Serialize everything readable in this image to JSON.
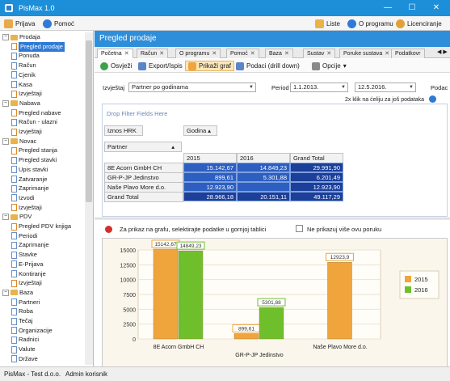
{
  "window": {
    "title": "PisMax 1.0"
  },
  "menu": {
    "items": [
      {
        "label": "Prijava"
      },
      {
        "label": "Pomoć"
      }
    ],
    "right": [
      {
        "label": "Liste"
      },
      {
        "label": "O programu"
      },
      {
        "label": "Licenciranje"
      }
    ]
  },
  "sidebar": {
    "items": [
      {
        "label": "Prodaja",
        "level": 0,
        "type": "group"
      },
      {
        "label": "Pregled prodaje",
        "level": 1,
        "type": "chart",
        "selected": true
      },
      {
        "label": "Ponuda",
        "level": 1,
        "type": "doc"
      },
      {
        "label": "Račun",
        "level": 1,
        "type": "doc"
      },
      {
        "label": "Cjenik",
        "level": 1,
        "type": "doc"
      },
      {
        "label": "Kasa",
        "level": 1,
        "type": "doc"
      },
      {
        "label": "Izvještaji",
        "level": 1,
        "type": "chart"
      },
      {
        "label": "Nabava",
        "level": 0,
        "type": "group"
      },
      {
        "label": "Pregled nabave",
        "level": 1,
        "type": "chart"
      },
      {
        "label": "Račun - ulazni",
        "level": 1,
        "type": "doc"
      },
      {
        "label": "Izvještaji",
        "level": 1,
        "type": "chart"
      },
      {
        "label": "Novac",
        "level": 0,
        "type": "group"
      },
      {
        "label": "Pregled stanja",
        "level": 1,
        "type": "chart"
      },
      {
        "label": "Pregled stavki",
        "level": 1,
        "type": "doc"
      },
      {
        "label": "Upis stavki",
        "level": 1,
        "type": "doc"
      },
      {
        "label": "Zatvaranje",
        "level": 1,
        "type": "doc"
      },
      {
        "label": "Zaprimanje",
        "level": 1,
        "type": "doc"
      },
      {
        "label": "Izvodi",
        "level": 1,
        "type": "doc"
      },
      {
        "label": "Izvještaji",
        "level": 1,
        "type": "chart"
      },
      {
        "label": "PDV",
        "level": 0,
        "type": "group"
      },
      {
        "label": "Pregled PDV knjiga",
        "level": 1,
        "type": "chart"
      },
      {
        "label": "Periodi",
        "level": 1,
        "type": "doc"
      },
      {
        "label": "Zaprimanje",
        "level": 1,
        "type": "doc"
      },
      {
        "label": "Stavke",
        "level": 1,
        "type": "doc"
      },
      {
        "label": "E-Prijava",
        "level": 1,
        "type": "doc"
      },
      {
        "label": "Kontiranje",
        "level": 1,
        "type": "doc"
      },
      {
        "label": "Izvještaji",
        "level": 1,
        "type": "chart"
      },
      {
        "label": "Baza",
        "level": 0,
        "type": "group"
      },
      {
        "label": "Partneri",
        "level": 1,
        "type": "doc"
      },
      {
        "label": "Roba",
        "level": 1,
        "type": "doc"
      },
      {
        "label": "Tečaj",
        "level": 1,
        "type": "doc"
      },
      {
        "label": "Organizacije",
        "level": 1,
        "type": "doc"
      },
      {
        "label": "Radnici",
        "level": 1,
        "type": "doc"
      },
      {
        "label": "Valute",
        "level": 1,
        "type": "doc"
      },
      {
        "label": "Države",
        "level": 1,
        "type": "doc"
      }
    ]
  },
  "content": {
    "title": "Pregled prodaje",
    "tabs": [
      {
        "label": "Početna"
      },
      {
        "label": "Račun"
      },
      {
        "label": "O programu"
      },
      {
        "label": "Pomoć"
      },
      {
        "label": "Baza"
      },
      {
        "label": "Sustav"
      },
      {
        "label": "Poruke sustava"
      },
      {
        "label": "Podatkovr"
      }
    ],
    "toolbar": [
      {
        "label": "Osvježi"
      },
      {
        "label": "Export/Ispis"
      },
      {
        "label": "Prikaži graf"
      },
      {
        "label": "Podaci (drill down)"
      },
      {
        "label": "Opcije"
      }
    ],
    "filter": {
      "report_label": "Izvještaj",
      "report_value": "Partner po godinama",
      "period_label": "Period",
      "date_from": "1.1.2013.",
      "date_to": "12.5.2016.",
      "extra_label": "Podac",
      "hint": "2x klik na ćeliju za još podataka"
    },
    "pivot": {
      "drop_filter": "Drop Filter Fields Here",
      "data_field": "Iznos HRK",
      "column_field": "Godina",
      "row_field": "Partner",
      "columns": [
        "2015",
        "2016",
        "Grand Total"
      ],
      "rows": [
        {
          "name": "8E Acorn GmbH CH",
          "values": [
            "15.142,67",
            "14.849,23",
            "29.991,90"
          ]
        },
        {
          "name": "GR-P-JP Jedinstvo",
          "values": [
            "899,61",
            "5.301,88",
            "6.201,49"
          ]
        },
        {
          "name": "Naše Plavo More d.o.",
          "values": [
            "12.923,90",
            "",
            "12.923,90"
          ]
        }
      ],
      "total": {
        "name": "Grand Total",
        "values": [
          "28.966,18",
          "20.151,11",
          "49.117,29"
        ]
      }
    },
    "info": {
      "message": "Za prikaz na grafu, selektirajte podatke u gornjoj tablici",
      "checkbox_label": "Ne prikazuj više ovu poruku"
    }
  },
  "chart_data": {
    "type": "bar",
    "categories": [
      "8E Acorn GmbH CH",
      "GR-P-JP Jedinstvo",
      "Naše Plavo More d.o."
    ],
    "series": [
      {
        "name": "2015",
        "values": [
          15142.67,
          899.61,
          12923.9
        ],
        "labels": [
          "15142,67",
          "899,61",
          "12923,9"
        ],
        "color": "#f0a53c"
      },
      {
        "name": "2016",
        "values": [
          14849.23,
          5301.88,
          null
        ],
        "labels": [
          "14849,23",
          "5301,88",
          ""
        ],
        "color": "#6fbf2c"
      }
    ],
    "ylim": [
      0,
      15000
    ],
    "yticks": [
      "0",
      "2500",
      "5000",
      "7500",
      "10000",
      "12500",
      "15000"
    ],
    "legend": "right"
  },
  "status": {
    "left": "PisMax - Test d.o.o.",
    "right": "Admin korisnik"
  }
}
